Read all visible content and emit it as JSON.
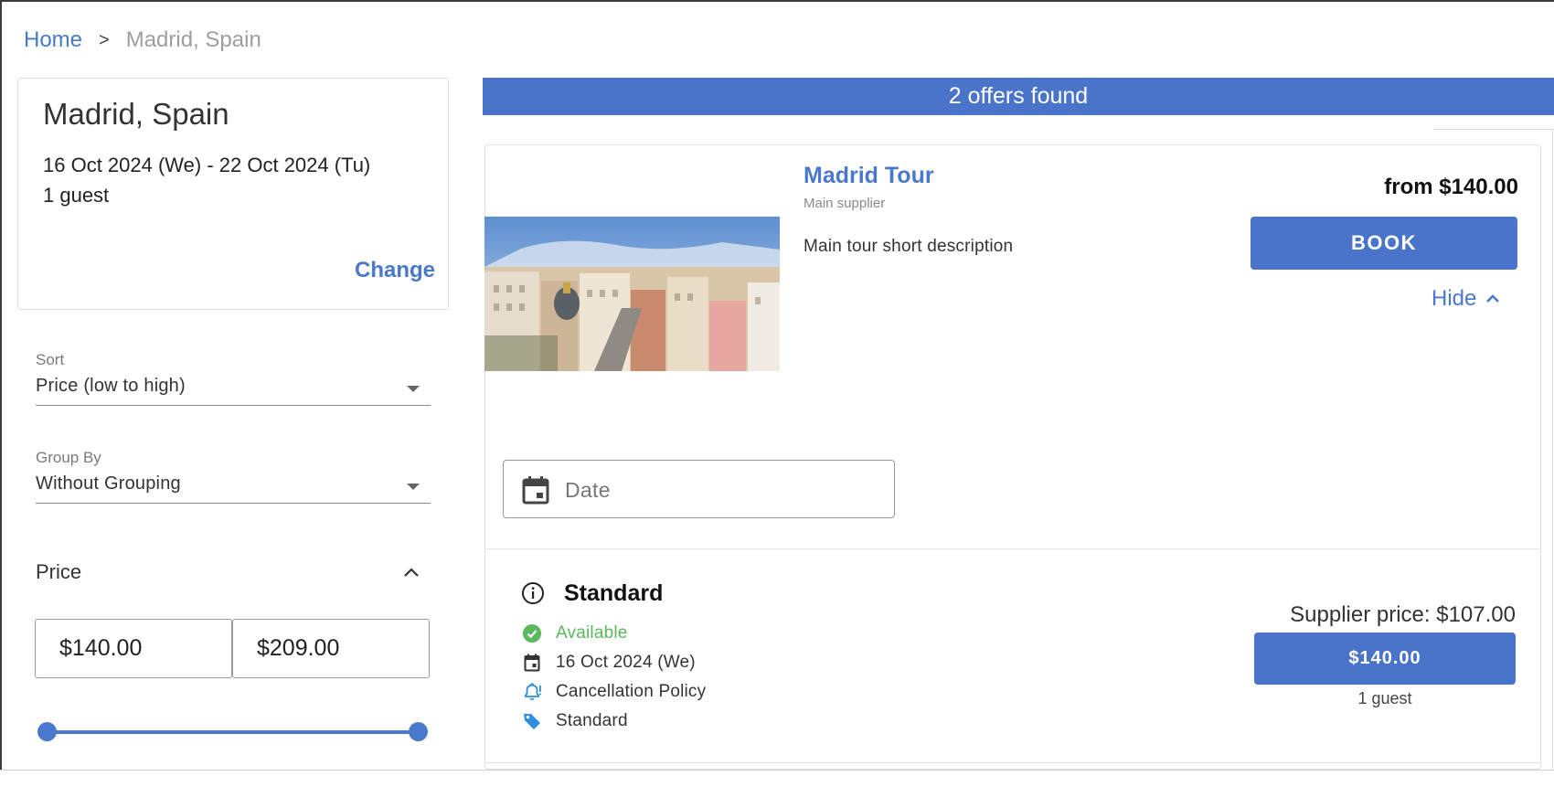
{
  "breadcrumb": {
    "home": "Home",
    "separator": ">",
    "current": "Madrid, Spain"
  },
  "search": {
    "city": "Madrid, Spain",
    "dates": "16 Oct 2024 (We) - 22 Oct 2024 (Tu)",
    "guests": "1 guest",
    "change_label": "Change"
  },
  "filters": {
    "sort": {
      "label": "Sort",
      "value": "Price (low to high)"
    },
    "group_by": {
      "label": "Group By",
      "value": "Without Grouping"
    },
    "price": {
      "title": "Price",
      "min": "$140.00",
      "max": "$209.00",
      "slider_min_fraction": 0,
      "slider_max_fraction": 1
    }
  },
  "results": {
    "count_text": "2 offers found",
    "offer": {
      "title": "Madrid Tour",
      "supplier": "Main supplier",
      "description": "Main tour short description",
      "from_price": "from $140.00",
      "book_label": "BOOK",
      "hide_label": "Hide",
      "date_placeholder": "Date",
      "variant": {
        "title": "Standard",
        "availability": "Available",
        "date": "16 Oct 2024 (We)",
        "cancellation": "Cancellation Policy",
        "rate": "Standard",
        "supplier_price": "Supplier price: $107.00",
        "price_button": "$140.00",
        "guests": "1 guest"
      }
    }
  },
  "colors": {
    "accent": "#4a74c9",
    "link": "#4a79cc",
    "available": "#5cb85c"
  }
}
